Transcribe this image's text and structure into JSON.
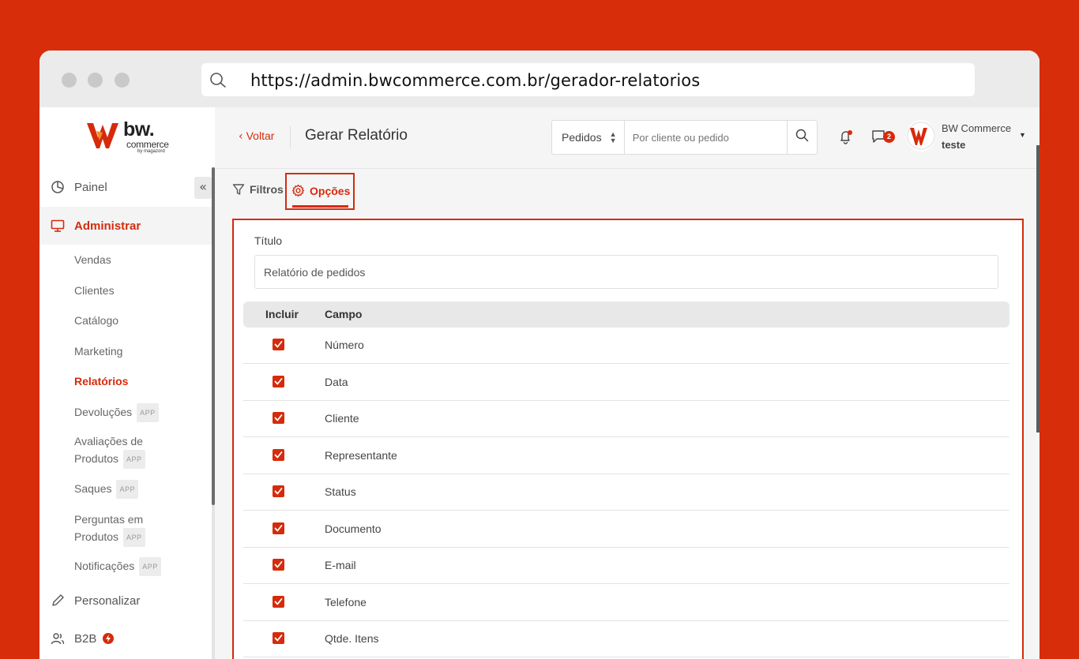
{
  "browser": {
    "url": "https://admin.bwcommerce.com.br/gerador-relatorios"
  },
  "brand": {
    "logo_text": "bw.",
    "logo_sub": "commerce",
    "logo_by": "by magazord",
    "accent_color": "#d52b0c"
  },
  "sidebar": {
    "collapse_icon": "«",
    "painel": "Painel",
    "administrar": "Administrar",
    "sub_items": [
      {
        "label": "Vendas"
      },
      {
        "label": "Clientes"
      },
      {
        "label": "Catálogo"
      },
      {
        "label": "Marketing"
      },
      {
        "label": "Relatórios"
      },
      {
        "label": "Devoluções",
        "badge": "APP"
      },
      {
        "label_line1": "Avaliações de",
        "label_line2": "Produtos",
        "badge": "APP"
      },
      {
        "label": "Saques",
        "badge": "APP"
      },
      {
        "label_line1": "Perguntas em",
        "label_line2": "Produtos",
        "badge": "APP"
      },
      {
        "label": "Notificações",
        "badge": "APP"
      }
    ],
    "personalizar": "Personalizar",
    "b2b": "B2B"
  },
  "header": {
    "back_label": "Voltar",
    "title": "Gerar Relatório",
    "search_select": "Pedidos",
    "search_placeholder": "Por cliente ou pedido",
    "chat_count": "2",
    "user_name": "BW Commerce",
    "user_sub": "teste"
  },
  "tabs": {
    "filtros": "Filtros",
    "opcoes": "Opções"
  },
  "options": {
    "title_label": "Título",
    "title_value": "Relatório de pedidos",
    "col_include": "Incluir",
    "col_field": "Campo",
    "fields": [
      "Número",
      "Data",
      "Cliente",
      "Representante",
      "Status",
      "Documento",
      "E-mail",
      "Telefone",
      "Qtde. Itens"
    ]
  }
}
